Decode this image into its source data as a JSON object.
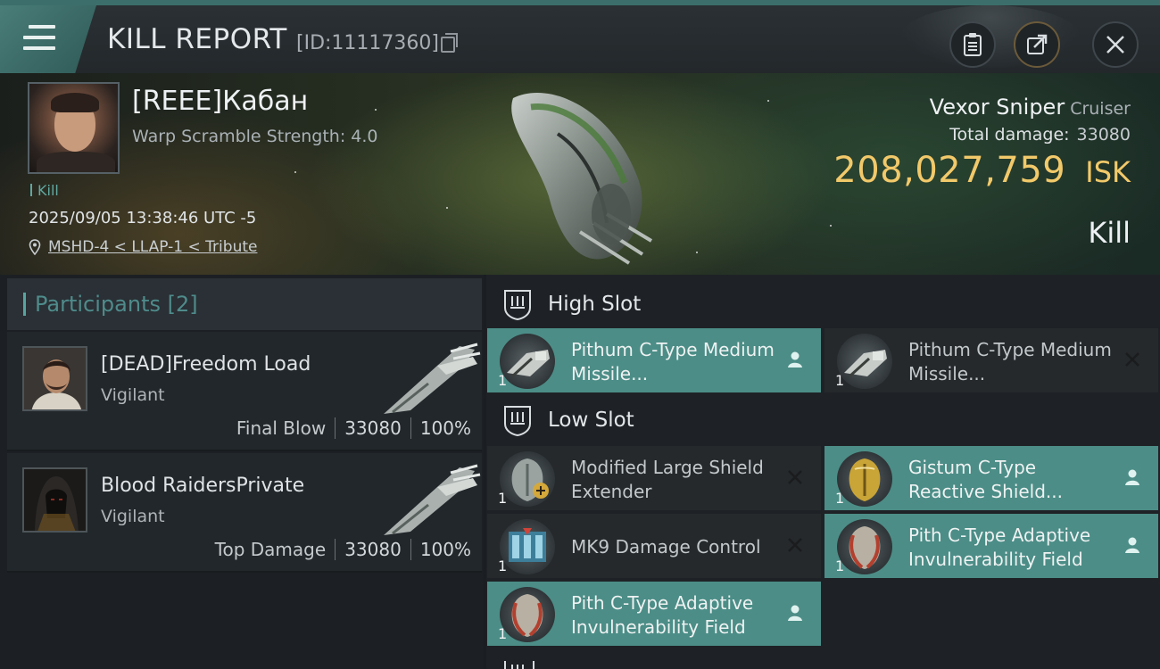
{
  "header": {
    "title": "KILL REPORT",
    "report_id": "[ID:11117360]"
  },
  "victim": {
    "name": "[REEE]Кабан",
    "warp": "Warp Scramble Strength: 4.0",
    "tag": "Kill",
    "datetime": "2025/09/05 13:38:46 UTC -5",
    "location": "MSHD-4 < LLAP-1 < Tribute",
    "ship_name": "Vexor Sniper",
    "ship_class": "Cruiser",
    "total_damage_label": "Total damage:",
    "total_damage": "33080",
    "isk_value": "208,027,759",
    "isk_unit": "ISK",
    "result": "Kill"
  },
  "participants": {
    "title": "Participants [2]",
    "rows": [
      {
        "name": "[DEAD]Freedom Load",
        "ship": "Vigilant",
        "label": "Final Blow",
        "damage": "33080",
        "percent": "100%"
      },
      {
        "name": "Blood RaidersPrivate",
        "ship": "Vigilant",
        "label": "Top Damage",
        "damage": "33080",
        "percent": "100%"
      }
    ]
  },
  "fitting": {
    "high_slot": "High Slot",
    "low_slot": "Low Slot",
    "high": [
      {
        "name": "Pithum C-Type Medium Missile...",
        "qty": "1",
        "state": "dropped"
      },
      {
        "name": "Pithum C-Type Medium Missile...",
        "qty": "1",
        "state": "destroyed"
      }
    ],
    "low": [
      {
        "name": "Modified Large Shield Extender",
        "qty": "1",
        "state": "destroyed"
      },
      {
        "name": "Gistum C-Type Reactive Shield...",
        "qty": "1",
        "state": "dropped"
      },
      {
        "name": "MK9 Damage Control",
        "qty": "1",
        "state": "destroyed"
      },
      {
        "name": "Pith C-Type Adaptive Invulnerability Field",
        "qty": "1",
        "state": "dropped"
      },
      {
        "name": "Pith C-Type Adaptive Invulnerability Field",
        "qty": "1",
        "state": "dropped"
      }
    ]
  },
  "colors": {
    "accent": "#4c8d87",
    "isk": "#f2c96a",
    "header_bar": "#3c6f6b"
  },
  "icons": [
    "menu-icon",
    "copy-icon",
    "clipboard-icon",
    "share-icon",
    "close-icon",
    "location-pin-icon",
    "high-slot-icon",
    "low-slot-icon",
    "person-icon",
    "x-icon"
  ]
}
